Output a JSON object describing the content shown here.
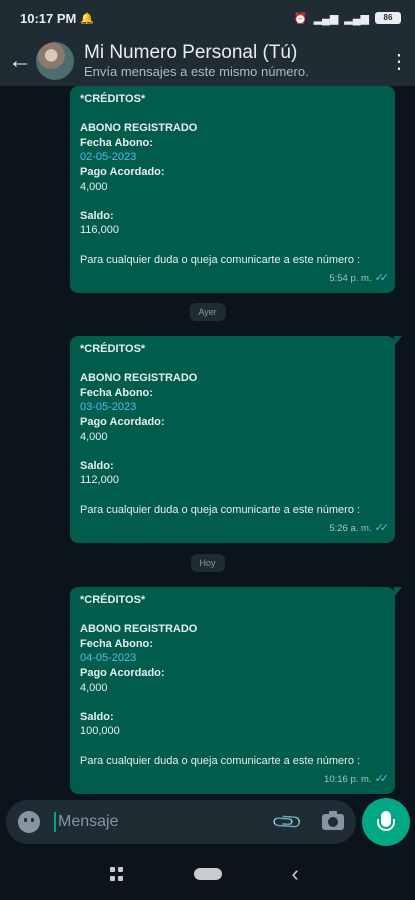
{
  "status_bar": {
    "time": "10:17 PM",
    "battery": "86"
  },
  "header": {
    "contact_name": "Mi Numero Personal (Tú)",
    "subtitle": "Envía mensajes a este mismo número."
  },
  "messages": [
    {
      "header": "*CRÉDITOS*",
      "status": "ABONO REGISTRADO",
      "fecha_label": "Fecha Abono:",
      "fecha": "02-05-2023",
      "pago_label": "Pago Acordado:",
      "pago": "4,000",
      "saldo_label": "Saldo:",
      "saldo": "116,000",
      "footer": "Para cualquier duda o queja comunicarte a este número :",
      "time": "5:54 p. m."
    },
    {
      "header": "*CRÉDITOS*",
      "status": "ABONO REGISTRADO",
      "fecha_label": "Fecha Abono:",
      "fecha": "03-05-2023",
      "pago_label": "Pago Acordado:",
      "pago": "4,000",
      "saldo_label": "Saldo:",
      "saldo": "112,000",
      "footer": "Para cualquier duda o queja comunicarte a este número :",
      "time": "5:26 a. m."
    },
    {
      "header": "*CRÉDITOS*",
      "status": "ABONO REGISTRADO",
      "fecha_label": "Fecha Abono:",
      "fecha": "04-05-2023",
      "pago_label": "Pago Acordado:",
      "pago": "4,000",
      "saldo_label": "Saldo:",
      "saldo": "100,000",
      "footer": "Para cualquier duda o queja comunicarte a este número :",
      "time": "10:16 p. m."
    }
  ],
  "date_chips": {
    "ayer": "Ayer",
    "hoy": "Hoy"
  },
  "composer": {
    "placeholder": "Mensaje"
  },
  "icons": {
    "back": "back-arrow-icon",
    "menu": "more-vert-icon",
    "emoji": "emoji-icon",
    "attach": "paperclip-icon",
    "camera": "camera-icon",
    "mic": "mic-icon"
  },
  "colors": {
    "bubble_outgoing": "#005c4b",
    "accent": "#00a884",
    "link": "#53bdeb",
    "header_bg": "#1f2c34"
  }
}
